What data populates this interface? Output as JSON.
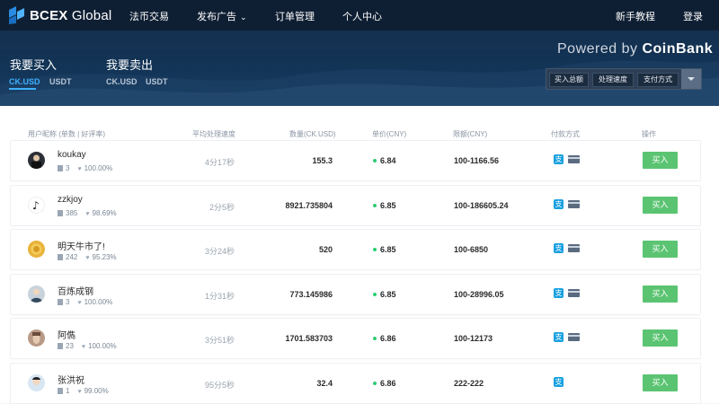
{
  "header": {
    "brand_bold": "BCEX",
    "brand_rest": " Global",
    "nav": [
      "法币交易",
      "发布广告",
      "订单管理",
      "个人中心"
    ],
    "right": [
      "新手教程",
      "登录"
    ]
  },
  "hero": {
    "buy_title": "我要买入",
    "sell_title": "我要卖出",
    "buy_tabs": [
      "CK.USD",
      "USDT"
    ],
    "sell_tabs": [
      "CK.USD",
      "USDT"
    ],
    "powered_prefix": "Powered by ",
    "powered_brand": "CoinBank",
    "filters": [
      "买入总额",
      "处理速度",
      "支付方式"
    ]
  },
  "table": {
    "headers": [
      "用户昵称 (单数 | 好评率)",
      "平均处理速度",
      "数量(CK.USD)",
      "单价(CNY)",
      "限额(CNY)",
      "付款方式",
      "操作"
    ],
    "rows": [
      {
        "name": "koukay",
        "orders": "3",
        "rate": "100.00%",
        "speed": "4分17秒",
        "qty": "155.3",
        "price": "6.84",
        "limit": "100-1166.56",
        "card": true,
        "action": "买入"
      },
      {
        "name": "zzkjoy",
        "orders": "385",
        "rate": "98.69%",
        "speed": "2分5秒",
        "qty": "8921.735804",
        "price": "6.85",
        "limit": "100-186605.24",
        "card": true,
        "action": "买入"
      },
      {
        "name": "明天牛市了!",
        "orders": "242",
        "rate": "95.23%",
        "speed": "3分24秒",
        "qty": "520",
        "price": "6.85",
        "limit": "100-6850",
        "card": true,
        "action": "买入"
      },
      {
        "name": "百炼成钢",
        "orders": "3",
        "rate": "100.00%",
        "speed": "1分31秒",
        "qty": "773.145986",
        "price": "6.85",
        "limit": "100-28996.05",
        "card": true,
        "action": "买入"
      },
      {
        "name": "阿儁",
        "orders": "23",
        "rate": "100.00%",
        "speed": "3分51秒",
        "qty": "1701.583703",
        "price": "6.86",
        "limit": "100-12173",
        "card": true,
        "action": "买入"
      },
      {
        "name": "张洪祝",
        "orders": "1",
        "rate": "99.00%",
        "speed": "95分5秒",
        "qty": "32.4",
        "price": "6.86",
        "limit": "222-222",
        "card": false,
        "action": "买入"
      }
    ]
  },
  "colors": {
    "accent": "#3fb0ff",
    "buy": "#5bc472",
    "dark": "#0f1f33"
  }
}
